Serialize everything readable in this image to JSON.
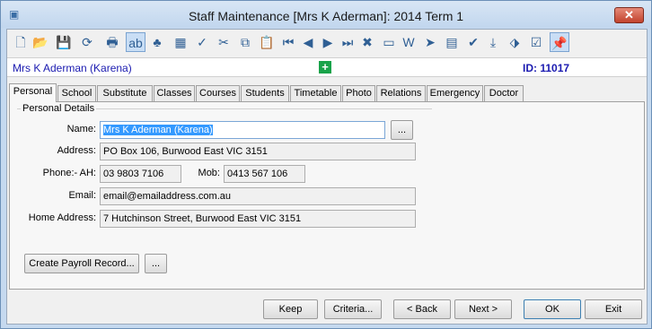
{
  "window": {
    "title": "Staff Maintenance  [Mrs K Aderman]:  2014 Term 1",
    "close_label": "✕"
  },
  "toolbar": {
    "icons": [
      "new-icon",
      "open-folder-icon",
      "save-icon",
      "refresh-icon",
      "print-icon",
      "text-field-icon",
      "tree-icon",
      "calculator-icon",
      "spellcheck-icon",
      "cut-icon",
      "copy-icon",
      "paste-icon",
      "first-record-icon",
      "previous-record-icon",
      "next-record-icon",
      "last-record-icon",
      "delete-icon",
      "card-icon",
      "word-document-icon",
      "arrow-icon",
      "clipboard-icon",
      "approve-icon",
      "download-icon",
      "tag-icon",
      "checklist-icon",
      "pin-icon"
    ],
    "glyphs": [
      "🗋",
      "📂",
      "💾",
      "⟳",
      "🖶",
      "ab",
      "♣",
      "▦",
      "✓",
      "✂",
      "⧉",
      "📋",
      "⏮",
      "◀",
      "▶",
      "⏭",
      "✖",
      "▭",
      "W",
      "➤",
      "▤",
      "✔",
      "⤓",
      "⬗",
      "☑",
      "📌"
    ]
  },
  "header": {
    "staff_name": "Mrs K Aderman (Karena)",
    "staff_id": "ID: 11017",
    "plus_glyph": "+"
  },
  "tabs": [
    "Personal",
    "School",
    "Substitute",
    "Classes",
    "Courses",
    "Students",
    "Timetable",
    "Photo",
    "Relations",
    "Emergency",
    "Doctor"
  ],
  "personal": {
    "group_title": "Personal Details",
    "name_label": "Name:",
    "name_value": "Mrs K Aderman  (Karena)",
    "name_lookup": "...",
    "address_label": "Address:",
    "address_value": "PO Box 106, Burwood East VIC 3151",
    "phone_label": "Phone:-  AH:",
    "phone_ah_value": "03 9803 7106",
    "mob_label": "Mob:",
    "mob_value": "0413 567 106",
    "email_label": "Email:",
    "email_value": "email@emailaddress.com.au",
    "home_label": "Home Address:",
    "home_value": "7 Hutchinson Street, Burwood East VIC 3151",
    "payroll_button": "Create Payroll Record...",
    "payroll_more": "..."
  },
  "buttons": {
    "keep": "Keep",
    "criteria": "Criteria...",
    "back": "< Back",
    "next": "Next >",
    "ok": "OK",
    "exit": "Exit"
  }
}
